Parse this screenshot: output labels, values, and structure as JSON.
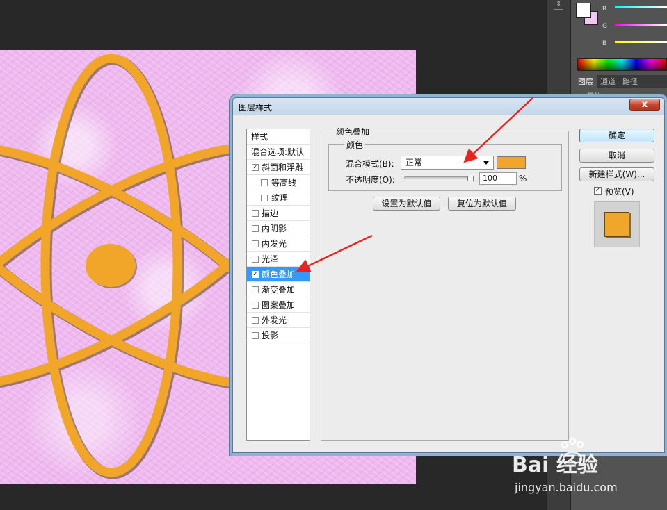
{
  "dialog": {
    "title": "图层样式",
    "close": "x",
    "styles_header": "样式",
    "blend_options": "混合选项:默认",
    "items": [
      {
        "label": "斜面和浮雕",
        "checked": true,
        "indent": false,
        "selected": false
      },
      {
        "label": "等高线",
        "checked": false,
        "indent": true,
        "selected": false
      },
      {
        "label": "纹理",
        "checked": false,
        "indent": true,
        "selected": false
      },
      {
        "label": "描边",
        "checked": false,
        "indent": false,
        "selected": false
      },
      {
        "label": "内阴影",
        "checked": false,
        "indent": false,
        "selected": false
      },
      {
        "label": "内发光",
        "checked": false,
        "indent": false,
        "selected": false
      },
      {
        "label": "光泽",
        "checked": false,
        "indent": false,
        "selected": false
      },
      {
        "label": "颜色叠加",
        "checked": true,
        "indent": false,
        "selected": true
      },
      {
        "label": "渐变叠加",
        "checked": false,
        "indent": false,
        "selected": false
      },
      {
        "label": "图案叠加",
        "checked": false,
        "indent": false,
        "selected": false
      },
      {
        "label": "外发光",
        "checked": false,
        "indent": false,
        "selected": false
      },
      {
        "label": "投影",
        "checked": false,
        "indent": false,
        "selected": false
      }
    ],
    "section_title": "颜色叠加",
    "group_title": "颜色",
    "blend_mode_label": "混合模式(B):",
    "blend_mode_value": "正常",
    "overlay_color": "#f0a52b",
    "opacity_label": "不透明度(O):",
    "opacity_value": "100",
    "opacity_percent": 100,
    "percent_sign": "%",
    "make_default": "设置为默认值",
    "reset_default": "复位为默认值",
    "ok": "确定",
    "cancel": "取消",
    "new_style": "新建样式(W)...",
    "preview_label": "预览(V)",
    "preview_checked": true
  },
  "panel": {
    "channels": [
      "R",
      "G",
      "B"
    ],
    "tabs": [
      "图层",
      "通道",
      "路径"
    ],
    "kind_label": "类型"
  },
  "watermark": {
    "logo": "Bai  经验",
    "url": "jingyan.baidu.com"
  }
}
